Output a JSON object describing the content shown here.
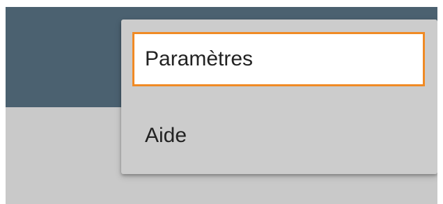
{
  "menu": {
    "items": [
      {
        "label": "Paramètres",
        "focused": true
      },
      {
        "label": "Aide",
        "focused": false
      }
    ]
  },
  "colors": {
    "toolbar": "#4b6170",
    "background": "#c9c9c9",
    "menu_background": "#cccccc",
    "focus_outline": "#f08a24",
    "focused_item_background": "#ffffff",
    "text": "#222222"
  }
}
